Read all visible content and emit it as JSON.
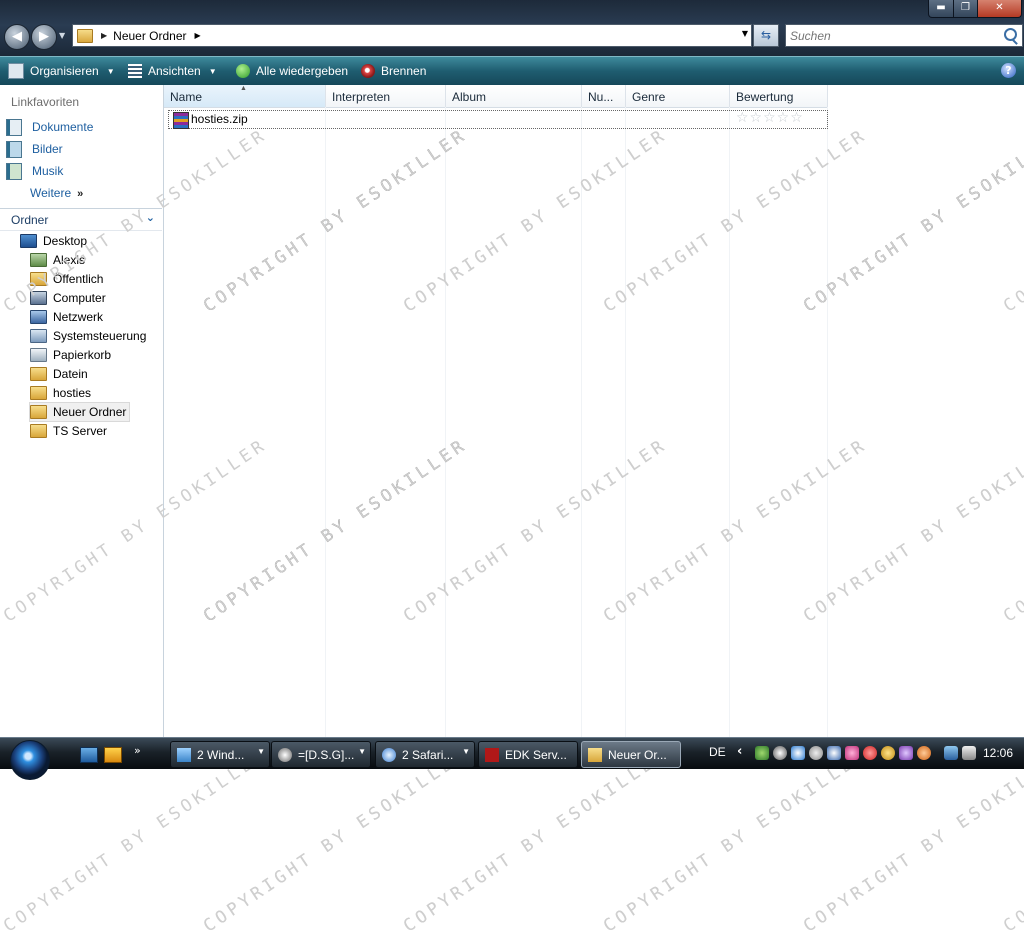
{
  "window_controls": {
    "minimize": "▬",
    "maximize": "❐",
    "close": "✕"
  },
  "address": {
    "crumb_arrow": "▶",
    "path": "Neuer Ordner",
    "drop_arrow": "▼",
    "refresh_glyph": "⇆"
  },
  "search": {
    "placeholder": "Suchen"
  },
  "toolbar": {
    "organize": "Organisieren",
    "views": "Ansichten",
    "play_all": "Alle wiedergeben",
    "burn": "Brennen",
    "dropdown_glyph": "▼",
    "help_glyph": "?"
  },
  "nav": {
    "favorites_header": "Linkfavoriten",
    "favorites": [
      {
        "label": "Dokumente",
        "icon": "documents-icon"
      },
      {
        "label": "Bilder",
        "icon": "pictures-icon"
      },
      {
        "label": "Musik",
        "icon": "music-icon"
      }
    ],
    "more": "Weitere",
    "more_glyph": "»",
    "folders_header": "Ordner",
    "folders_chevron": "⌄",
    "tree": [
      {
        "label": "Desktop",
        "icon": "desktop-icon"
      },
      {
        "label": "Alexis",
        "icon": "user-folder-icon"
      },
      {
        "label": "Öffentlich",
        "icon": "folder-icon"
      },
      {
        "label": "Computer",
        "icon": "computer-icon"
      },
      {
        "label": "Netzwerk",
        "icon": "network-icon"
      },
      {
        "label": "Systemsteuerung",
        "icon": "control-panel-icon"
      },
      {
        "label": "Papierkorb",
        "icon": "recycle-bin-icon"
      },
      {
        "label": "Datein",
        "icon": "folder-icon"
      },
      {
        "label": "hosties",
        "icon": "folder-icon"
      },
      {
        "label": "Neuer Ordner",
        "icon": "folder-icon",
        "selected": true
      },
      {
        "label": "TS Server",
        "icon": "folder-icon"
      }
    ]
  },
  "files": {
    "columns": [
      "Name",
      "Interpreten",
      "Album",
      "Nu...",
      "Genre",
      "Bewertung"
    ],
    "sort_glyph": "▲",
    "rows": [
      {
        "name": "hosties.zip",
        "icon": "zip-archive-icon",
        "rating": 0,
        "rating_stars": "☆☆☆☆☆"
      }
    ]
  },
  "watermark": "COPYRIGHT BY ESOKILLER",
  "taskbar": {
    "quicklaunch_more": "»",
    "tasks": [
      {
        "label": "2 Wind...",
        "icon": "windows-explorer-icon",
        "grouped": true
      },
      {
        "label": "=[D.S.G]...",
        "icon": "steam-icon",
        "grouped": true
      },
      {
        "label": "2 Safari...",
        "icon": "safari-icon",
        "grouped": true
      },
      {
        "label": "EDK Serv...",
        "icon": "filezilla-icon",
        "grouped": false
      },
      {
        "label": "Neuer Or...",
        "icon": "folder-icon",
        "grouped": false,
        "active": true
      }
    ],
    "language": "DE",
    "tray_chevron": "‹",
    "clock": "12:06"
  }
}
